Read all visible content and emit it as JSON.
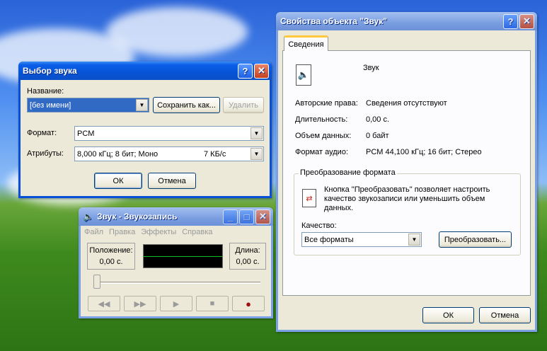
{
  "select_sound": {
    "title": "Выбор звука",
    "name_label": "Название:",
    "name_value": "[без имени]",
    "save_as_label": "Сохранить как...",
    "delete_label": "Удалить",
    "format_label": "Формат:",
    "format_value": "PCM",
    "attributes_label": "Атрибуты:",
    "attributes_value": "8,000 кГц; 8 бит; Моно",
    "attributes_rate": "7 КБ/с",
    "ok_label": "ОК",
    "cancel_label": "Отмена"
  },
  "recorder": {
    "title": "Звук - Звукозапись",
    "menu": [
      "Файл",
      "Правка",
      "Эффекты",
      "Справка"
    ],
    "position_label": "Положение:",
    "position_value": "0,00 с.",
    "length_label": "Длина:",
    "length_value": "0,00 с.",
    "buttons": [
      "◀◀",
      "▶▶",
      "▶",
      "■",
      "●"
    ]
  },
  "properties": {
    "title": "Свойства объекта \"Звук\"",
    "tab": "Сведения",
    "object_name": "Звук",
    "rows": [
      {
        "label": "Авторские права:",
        "value": "Сведения отсутствуют"
      },
      {
        "label": "Длительность:",
        "value": "0,00 с."
      },
      {
        "label": "Объем данных:",
        "value": "0 байт"
      },
      {
        "label": "Формат аудио:",
        "value": "PCM 44,100 кГц; 16 бит; Стерео"
      }
    ],
    "group_title": "Преобразование формата",
    "group_text": "Кнопка \"Преобразовать\" позволяет настроить качество звукозаписи или уменьшить объем данных.",
    "quality_label": "Качество:",
    "quality_value": "Все форматы",
    "convert_label": "Преобразовать...",
    "ok_label": "ОК",
    "cancel_label": "Отмена"
  }
}
